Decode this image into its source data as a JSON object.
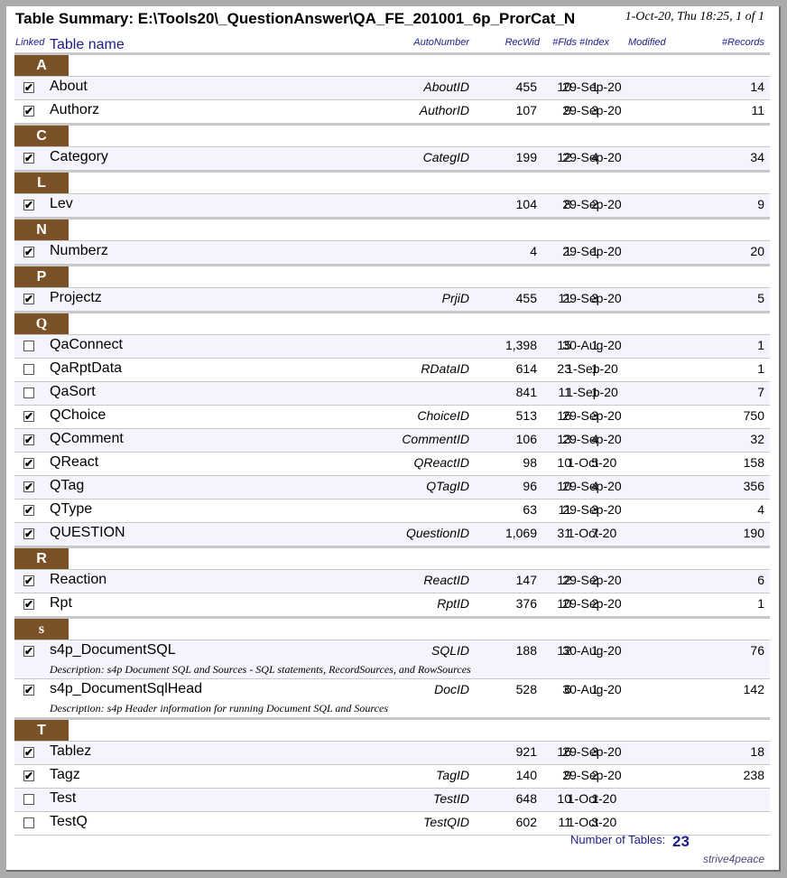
{
  "header": {
    "title": "Table Summary: E:\\Tools20\\_QuestionAnswer\\QA_FE_201001_6p_ProrCat_N",
    "page_info": "1-Oct-20, Thu 18:25,  1 of 1"
  },
  "columns": {
    "linked": "Linked",
    "table_name": "Table name",
    "autonumber": "AutoNumber",
    "recwid": "RecWid",
    "flds": "#Flds",
    "index": "#Index",
    "modified": "Modified",
    "records": "#Records"
  },
  "groups": [
    {
      "letter": "A",
      "rows": [
        {
          "linked": true,
          "name": "About",
          "auto": "AboutID",
          "recwid": "455",
          "flds": "10",
          "idx": "1",
          "mod": "29-Sep-20",
          "recs": "14"
        },
        {
          "linked": true,
          "name": "Authorz",
          "auto": "AuthorID",
          "recwid": "107",
          "flds": "9",
          "idx": "3",
          "mod": "29-Sep-20",
          "recs": "11"
        }
      ]
    },
    {
      "letter": "C",
      "rows": [
        {
          "linked": true,
          "name": "Category",
          "auto": "CategID",
          "recwid": "199",
          "flds": "12",
          "idx": "4",
          "mod": "29-Sep-20",
          "recs": "34"
        }
      ]
    },
    {
      "letter": "L",
      "rows": [
        {
          "linked": true,
          "name": "Lev",
          "auto": "",
          "recwid": "104",
          "flds": "8",
          "idx": "2",
          "mod": "29-Sep-20",
          "recs": "9"
        }
      ]
    },
    {
      "letter": "N",
      "rows": [
        {
          "linked": true,
          "name": "Numberz",
          "auto": "",
          "recwid": "4",
          "flds": "1",
          "idx": "1",
          "mod": "29-Sep-20",
          "recs": "20"
        }
      ]
    },
    {
      "letter": "P",
      "rows": [
        {
          "linked": true,
          "name": "Projectz",
          "auto": "PrjiD",
          "recwid": "455",
          "flds": "11",
          "idx": "3",
          "mod": "29-Sep-20",
          "recs": "5"
        }
      ]
    },
    {
      "letter": "Q",
      "rows": [
        {
          "linked": false,
          "name": "QaConnect",
          "auto": "",
          "recwid": "1,398",
          "flds": "15",
          "idx": "1",
          "mod": "30-Aug-20",
          "recs": "1"
        },
        {
          "linked": false,
          "name": "QaRptData",
          "auto": "RDataID",
          "recwid": "614",
          "flds": "23",
          "idx": "1",
          "mod": "1-Sep-20",
          "recs": "1"
        },
        {
          "linked": false,
          "name": "QaSort",
          "auto": "",
          "recwid": "841",
          "flds": "11",
          "idx": "1",
          "mod": "1-Sep-20",
          "recs": "7"
        },
        {
          "linked": true,
          "name": "QChoice",
          "auto": "ChoiceID",
          "recwid": "513",
          "flds": "16",
          "idx": "3",
          "mod": "29-Sep-20",
          "recs": "750"
        },
        {
          "linked": true,
          "name": "QComment",
          "auto": "CommentID",
          "recwid": "106",
          "flds": "13",
          "idx": "4",
          "mod": "29-Sep-20",
          "recs": "32"
        },
        {
          "linked": true,
          "name": "QReact",
          "auto": "QReactID",
          "recwid": "98",
          "flds": "10",
          "idx": "5",
          "mod": "1-Oct-20",
          "recs": "158"
        },
        {
          "linked": true,
          "name": "QTag",
          "auto": "QTagID",
          "recwid": "96",
          "flds": "10",
          "idx": "4",
          "mod": "29-Sep-20",
          "recs": "356"
        },
        {
          "linked": true,
          "name": "QType",
          "auto": "",
          "recwid": "63",
          "flds": "11",
          "idx": "3",
          "mod": "29-Sep-20",
          "recs": "4"
        },
        {
          "linked": true,
          "name": "QUESTION",
          "auto": "QuestionID",
          "recwid": "1,069",
          "flds": "31",
          "idx": "7",
          "mod": "1-Oct-20",
          "recs": "190"
        }
      ]
    },
    {
      "letter": "R",
      "rows": [
        {
          "linked": true,
          "name": "Reaction",
          "auto": "ReactID",
          "recwid": "147",
          "flds": "12",
          "idx": "2",
          "mod": "29-Sep-20",
          "recs": "6"
        },
        {
          "linked": true,
          "name": "Rpt",
          "auto": "RptID",
          "recwid": "376",
          "flds": "10",
          "idx": "2",
          "mod": "29-Sep-20",
          "recs": "1"
        }
      ]
    },
    {
      "letter": "s",
      "rows": [
        {
          "linked": true,
          "name": "s4p_DocumentSQL",
          "auto": "SQLID",
          "recwid": "188",
          "flds": "12",
          "idx": "1",
          "mod": "30-Aug-20",
          "recs": "76",
          "desc": "Description: s4p Document SQL and Sources - SQL statements, RecordSources, and RowSources"
        },
        {
          "linked": true,
          "name": "s4p_DocumentSqlHead",
          "auto": "DocID",
          "recwid": "528",
          "flds": "6",
          "idx": "1",
          "mod": "30-Aug-20",
          "recs": "142",
          "desc": "Description: s4p Header information for running Document SQL and Sources"
        }
      ]
    },
    {
      "letter": "T",
      "rows": [
        {
          "linked": true,
          "name": "Tablez",
          "auto": "",
          "recwid": "921",
          "flds": "16",
          "idx": "3",
          "mod": "29-Sep-20",
          "recs": "18"
        },
        {
          "linked": true,
          "name": "Tagz",
          "auto": "TagID",
          "recwid": "140",
          "flds": "9",
          "idx": "2",
          "mod": "29-Sep-20",
          "recs": "238"
        },
        {
          "linked": false,
          "name": "Test",
          "auto": "TestID",
          "recwid": "648",
          "flds": "10",
          "idx": "1",
          "mod": "1-Oct-20",
          "recs": ""
        },
        {
          "linked": false,
          "name": "TestQ",
          "auto": "TestQID",
          "recwid": "602",
          "flds": "11",
          "idx": "3",
          "mod": "1-Oct-20",
          "recs": ""
        }
      ]
    }
  ],
  "summary": {
    "label": "Number of Tables:",
    "count": "23"
  },
  "footer": "strive4peace",
  "colors": {
    "group_header_bg": "#7b5128",
    "heading_text": "#1c1c8c",
    "row_shade": "#f4f4fc"
  }
}
